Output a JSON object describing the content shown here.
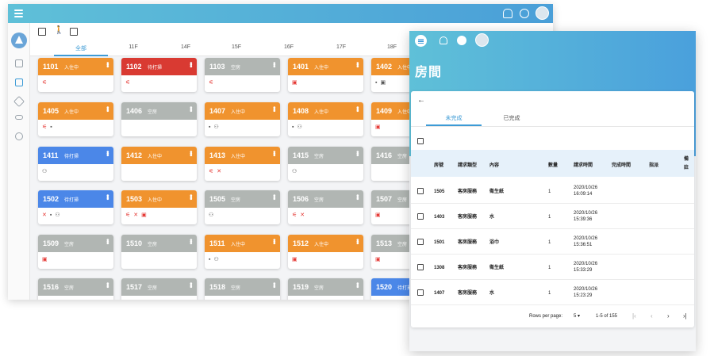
{
  "bg": {
    "tabs": [
      "全部",
      "11F",
      "14F",
      "15F",
      "16F",
      "17F",
      "18F"
    ],
    "rooms": [
      [
        {
          "num": "1101",
          "status": "入住中",
          "color": "orange",
          "icons": [
            [
              "r",
              "⚟"
            ]
          ]
        },
        {
          "num": "1102",
          "status": "待打掃",
          "color": "red",
          "icons": [
            [
              "r",
              "⚟"
            ]
          ]
        },
        {
          "num": "1103",
          "status": "空房",
          "color": "gray",
          "icons": [
            [
              "r",
              "⚟"
            ]
          ]
        },
        {
          "num": "1401",
          "status": "入住中",
          "color": "orange",
          "icons": [
            [
              "r",
              "▣"
            ]
          ]
        },
        {
          "num": "1402",
          "status": "入住中",
          "color": "orange",
          "icons": [
            [
              "",
              "▪"
            ],
            [
              "",
              "▣"
            ]
          ]
        }
      ],
      [
        {
          "num": "1405",
          "status": "入住中",
          "color": "orange",
          "icons": [
            [
              "r",
              "⚟"
            ],
            [
              "",
              "▪"
            ]
          ]
        },
        {
          "num": "1406",
          "status": "空房",
          "color": "gray",
          "icons": []
        },
        {
          "num": "1407",
          "status": "入住中",
          "color": "orange",
          "icons": [
            [
              "",
              "▪"
            ],
            [
              "",
              "⚇"
            ]
          ]
        },
        {
          "num": "1408",
          "status": "入住中",
          "color": "orange",
          "icons": [
            [
              "",
              "▪"
            ],
            [
              "",
              "⚇"
            ]
          ]
        },
        {
          "num": "1409",
          "status": "入住中",
          "color": "orange",
          "icons": [
            [
              "r",
              "▣"
            ]
          ]
        }
      ],
      [
        {
          "num": "1411",
          "status": "待打掃",
          "color": "blue",
          "icons": [
            [
              "",
              "⚇"
            ]
          ]
        },
        {
          "num": "1412",
          "status": "入住中",
          "color": "orange",
          "icons": []
        },
        {
          "num": "1413",
          "status": "入住中",
          "color": "orange",
          "icons": [
            [
              "r",
              "⚟"
            ],
            [
              "r",
              "✕"
            ]
          ]
        },
        {
          "num": "1415",
          "status": "空房",
          "color": "gray",
          "icons": [
            [
              "",
              "⚇"
            ]
          ]
        },
        {
          "num": "1416",
          "status": "空房",
          "color": "gray",
          "icons": []
        }
      ],
      [
        {
          "num": "1502",
          "status": "待打掃",
          "color": "blue",
          "icons": [
            [
              "r",
              "✕"
            ],
            [
              "",
              "▪"
            ],
            [
              "",
              "⚇"
            ]
          ]
        },
        {
          "num": "1503",
          "status": "入住中",
          "color": "orange",
          "icons": [
            [
              "r",
              "⚟"
            ],
            [
              "r",
              "✕"
            ],
            [
              "r",
              "▣"
            ]
          ]
        },
        {
          "num": "1505",
          "status": "空房",
          "color": "gray",
          "icons": [
            [
              "",
              "⚇"
            ]
          ]
        },
        {
          "num": "1506",
          "status": "空房",
          "color": "gray",
          "icons": [
            [
              "r",
              "⚟"
            ],
            [
              "r",
              "✕"
            ]
          ]
        },
        {
          "num": "1507",
          "status": "空房",
          "color": "gray",
          "icons": [
            [
              "r",
              "▣"
            ]
          ]
        }
      ],
      [
        {
          "num": "1509",
          "status": "空房",
          "color": "gray",
          "icons": [
            [
              "r",
              "▣"
            ]
          ]
        },
        {
          "num": "1510",
          "status": "空房",
          "color": "gray",
          "icons": []
        },
        {
          "num": "1511",
          "status": "入住中",
          "color": "orange",
          "icons": [
            [
              "",
              "▪"
            ],
            [
              "",
              "⚇"
            ]
          ]
        },
        {
          "num": "1512",
          "status": "入住中",
          "color": "orange",
          "icons": [
            [
              "r",
              "▣"
            ]
          ]
        },
        {
          "num": "1513",
          "status": "空房",
          "color": "gray",
          "icons": [
            [
              "r",
              "▣"
            ]
          ]
        }
      ],
      [
        {
          "num": "1516",
          "status": "空房",
          "color": "gray",
          "icons": []
        },
        {
          "num": "1517",
          "status": "空房",
          "color": "gray",
          "icons": []
        },
        {
          "num": "1518",
          "status": "空房",
          "color": "gray",
          "icons": []
        },
        {
          "num": "1519",
          "status": "空房",
          "color": "gray",
          "icons": []
        },
        {
          "num": "1520",
          "status": "待打掃",
          "color": "blue",
          "icons": []
        }
      ]
    ]
  },
  "fg": {
    "title": "房間",
    "tabs": [
      "未完成",
      "已完成"
    ],
    "headers": [
      "房號",
      "請求類型",
      "內容",
      "數量",
      "請求時間",
      "完成時間",
      "指派",
      "備註"
    ],
    "rows": [
      {
        "room": "1505",
        "type": "客房服務",
        "content": "衛生紙",
        "qty": "1",
        "date": "2020/10/26",
        "time": "16:09:14"
      },
      {
        "room": "1403",
        "type": "客房服務",
        "content": "水",
        "qty": "1",
        "date": "2020/10/26",
        "time": "15:39:36"
      },
      {
        "room": "1501",
        "type": "客房服務",
        "content": "浴巾",
        "qty": "1",
        "date": "2020/10/26",
        "time": "15:36:51"
      },
      {
        "room": "1308",
        "type": "客房服務",
        "content": "衛生紙",
        "qty": "1",
        "date": "2020/10/26",
        "time": "15:33:29"
      },
      {
        "room": "1407",
        "type": "客房服務",
        "content": "水",
        "qty": "1",
        "date": "2020/10/26",
        "time": "15:23:29"
      }
    ],
    "footer": {
      "rows_per_page_label": "Rows per page:",
      "rows_per_page_value": "5",
      "range": "1-5 of 155"
    }
  },
  "colors": {
    "orange": "#f0932e",
    "red": "#d93a32",
    "gray": "#b1b6b3",
    "blue": "#4b87e8",
    "accent": "#3d9bd6"
  }
}
